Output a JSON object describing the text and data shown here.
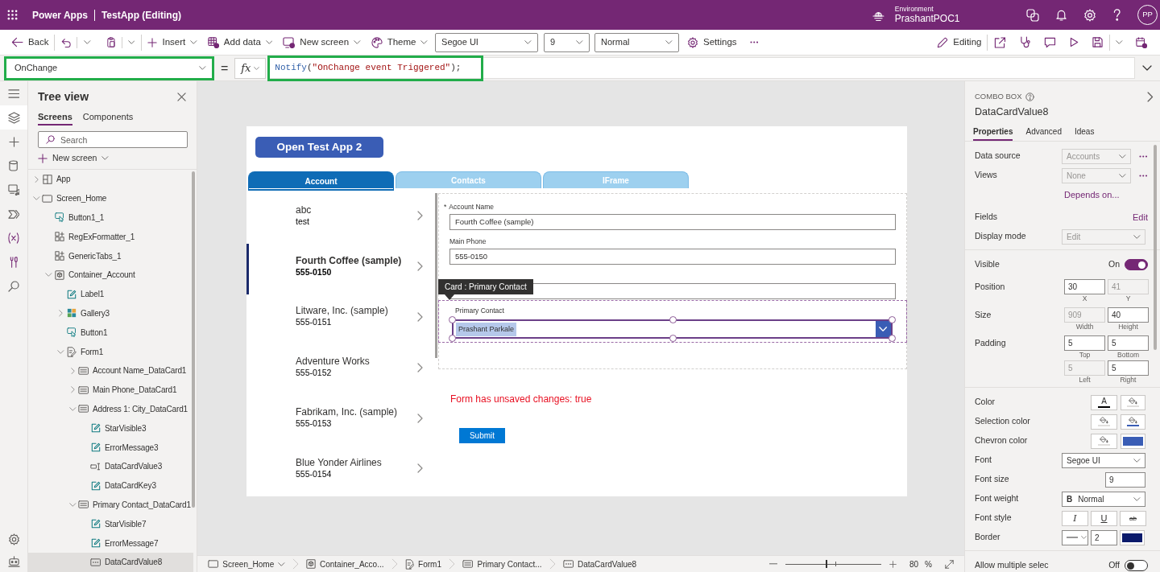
{
  "header": {
    "app_name": "Power Apps",
    "document_title": "TestApp (Editing)",
    "environment_label": "Environment",
    "environment_name": "PrashantPOC1",
    "avatar_initials": "PP"
  },
  "toolbar": {
    "back": "Back",
    "insert": "Insert",
    "add_data": "Add data",
    "new_screen": "New screen",
    "theme": "Theme",
    "font": "Segoe UI",
    "font_size": "9",
    "font_weight": "Normal",
    "settings": "Settings",
    "mode": "Editing"
  },
  "formula_bar": {
    "property": "OnChange",
    "property_highlighted": true,
    "equals": "=",
    "fx": "fx",
    "formula_highlighted": true,
    "formula": [
      {
        "kind": "function",
        "text": "Notify"
      },
      {
        "kind": "punctuation",
        "text": "("
      },
      {
        "kind": "string",
        "text": "\"OnChange event Triggered\""
      },
      {
        "kind": "punctuation",
        "text": ");"
      }
    ]
  },
  "rail": [
    {
      "selected": true
    },
    {
      "selected": false
    },
    {
      "selected": false
    },
    {
      "selected": false
    },
    {
      "selected": false
    },
    {
      "selected": false
    },
    {
      "selected": false
    },
    {
      "selected": false
    },
    {
      "selected": false
    },
    {
      "selected": false
    }
  ],
  "tree_view": {
    "title": "Tree view",
    "tabs": [
      {
        "label": "Screens",
        "selected": true
      },
      {
        "label": "Components",
        "selected": false
      }
    ],
    "search": {
      "placeholder": "Search"
    },
    "new_screen": "New screen",
    "items": [
      {
        "label": "App",
        "kind": "app",
        "expanded": false,
        "selected": false
      },
      {
        "label": "Screen_Home",
        "kind": "screen",
        "expanded": true,
        "selected": false,
        "children": [
          {
            "label": "Button1_1",
            "kind": "button",
            "selected": false
          },
          {
            "label": "RegExFormatter_1",
            "kind": "component",
            "selected": false
          },
          {
            "label": "GenericTabs_1",
            "kind": "component",
            "selected": false
          },
          {
            "label": "Container_Account",
            "kind": "container",
            "expanded": true,
            "selected": false,
            "children": [
              {
                "label": "Label1",
                "kind": "label",
                "selected": false
              },
              {
                "label": "Gallery3",
                "kind": "gallery",
                "expanded": false,
                "selected": false
              },
              {
                "label": "Button1",
                "kind": "button",
                "selected": false
              },
              {
                "label": "Form1",
                "kind": "form",
                "expanded": true,
                "selected": false,
                "children": [
                  {
                    "label": "Account Name_DataCard1",
                    "kind": "card",
                    "expanded": false,
                    "selected": false
                  },
                  {
                    "label": "Main Phone_DataCard1",
                    "kind": "card",
                    "expanded": false,
                    "selected": false
                  },
                  {
                    "label": "Address 1: City_DataCard1",
                    "kind": "card",
                    "expanded": true,
                    "selected": false,
                    "children": [
                      {
                        "label": "StarVisible3",
                        "kind": "label",
                        "selected": false
                      },
                      {
                        "label": "ErrorMessage3",
                        "kind": "label",
                        "selected": false
                      },
                      {
                        "label": "DataCardValue3",
                        "kind": "input",
                        "selected": false
                      },
                      {
                        "label": "DataCardKey3",
                        "kind": "label",
                        "selected": false
                      }
                    ]
                  },
                  {
                    "label": "Primary Contact_DataCard1",
                    "kind": "card",
                    "expanded": true,
                    "selected": false,
                    "children": [
                      {
                        "label": "StarVisible7",
                        "kind": "label",
                        "selected": false
                      },
                      {
                        "label": "ErrorMessage7",
                        "kind": "label",
                        "selected": false
                      },
                      {
                        "label": "DataCardValue8",
                        "kind": "combobox",
                        "selected": true
                      }
                    ]
                  }
                ]
              }
            ]
          }
        ]
      }
    ]
  },
  "canvas": {
    "open_button": "Open Test App 2",
    "tabs": [
      {
        "label": "Account",
        "selected": true
      },
      {
        "label": "Contacts",
        "selected": false
      },
      {
        "label": "IFrame",
        "selected": false
      }
    ],
    "gallery": [
      {
        "title": "abc",
        "subtitle": "test",
        "selected": false
      },
      {
        "title": "Fourth Coffee (sample)",
        "subtitle": "555-0150",
        "selected": true
      },
      {
        "title": "Litware, Inc. (sample)",
        "subtitle": "555-0151",
        "selected": false
      },
      {
        "title": "Adventure Works",
        "subtitle": "555-0152",
        "selected": false
      },
      {
        "title": "Fabrikam, Inc. (sample)",
        "subtitle": "555-0153",
        "selected": false
      },
      {
        "title": "Blue Yonder Airlines",
        "subtitle": "555-0154",
        "selected": false
      }
    ],
    "form_fields": [
      {
        "kind": "text",
        "label": "Account Name",
        "required_mark": "*",
        "value": "Fourth Coffee (sample)"
      },
      {
        "kind": "text",
        "label": "Main Phone",
        "value": "555-0150"
      },
      {
        "kind": "text"
      },
      {
        "kind": "combo",
        "label": "Primary Contact",
        "value": "Prashant Parkale",
        "selected": true
      }
    ],
    "tooltip": "Card : Primary Contact",
    "unsaved_message": "Form has unsaved changes: true",
    "submit_button": "Submit"
  },
  "properties_panel": {
    "control_type": "COMBO BOX",
    "control_name": "DataCardValue8",
    "tabs": [
      {
        "label": "Properties",
        "selected": true
      },
      {
        "label": "Advanced",
        "selected": false
      },
      {
        "label": "Ideas",
        "selected": false
      }
    ],
    "sections": [
      [
        {
          "kind": "dropdown",
          "label": "Data source",
          "value": "Accounts",
          "disabled": true,
          "more": true
        },
        {
          "kind": "dropdown",
          "label": "Views",
          "value": "None",
          "disabled": true,
          "more": true
        },
        {
          "kind": "link",
          "value": "Depends on..."
        },
        {
          "kind": "action",
          "label": "Fields",
          "value": "Edit"
        },
        {
          "kind": "dropdown",
          "label": "Display mode",
          "value": "Edit",
          "disabled": true
        }
      ],
      [
        {
          "kind": "toggle",
          "label": "Visible",
          "value": "On",
          "on": true
        },
        {
          "kind": "numbers",
          "label": "Position",
          "fields": [
            {
              "value": "30",
              "caption": "X",
              "disabled": false
            },
            {
              "value": "41",
              "caption": "Y",
              "disabled": true
            }
          ]
        },
        {
          "kind": "numbers",
          "label": "Size",
          "fields": [
            {
              "value": "909",
              "caption": "Width",
              "disabled": true
            },
            {
              "value": "40",
              "caption": "Height",
              "disabled": false
            }
          ]
        },
        {
          "kind": "numbers",
          "label": "Padding",
          "fields": [
            {
              "value": "5",
              "caption": "Top",
              "disabled": false
            },
            {
              "value": "5",
              "caption": "Bottom",
              "disabled": false
            },
            {
              "value": "5",
              "caption": "Left",
              "disabled": true
            },
            {
              "value": "5",
              "caption": "Right",
              "disabled": false
            }
          ]
        }
      ],
      [
        {
          "kind": "colors",
          "label": "Color",
          "swatches": [
            {
              "kind": "text",
              "glyph": "A",
              "color": "#000000"
            },
            {
              "kind": "fill",
              "color": "#e1dfdd"
            }
          ]
        },
        {
          "kind": "colors",
          "label": "Selection color",
          "swatches": [
            {
              "kind": "fill",
              "color": "#e1dfdd"
            },
            {
              "kind": "fill",
              "color": "#3a5db5"
            }
          ]
        },
        {
          "kind": "colors",
          "label": "Chevron color",
          "swatches": [
            {
              "kind": "fill",
              "color": "#e1dfdd"
            },
            {
              "kind": "solid",
              "color": "#3a5db5"
            }
          ]
        },
        {
          "kind": "dropdown",
          "label": "Font",
          "value": "Segoe UI",
          "disabled": false
        },
        {
          "kind": "input",
          "label": "Font size",
          "value": "9"
        },
        {
          "kind": "dropdown",
          "label": "Font weight",
          "prefix": "B",
          "value": "Normal",
          "disabled": false
        },
        {
          "kind": "styles",
          "label": "Font style",
          "buttons": [
            {
              "kind": "italic",
              "glyph": "I",
              "selected": false
            },
            {
              "kind": "underline",
              "glyph": "U",
              "selected": false
            },
            {
              "kind": "strike",
              "glyph": "ab",
              "selected": false
            }
          ]
        },
        {
          "kind": "border",
          "label": "Border",
          "value": "2",
          "color": "#0b1a6b"
        }
      ],
      [
        {
          "kind": "toggle",
          "label": "Allow multiple selec",
          "value": "Off",
          "on": false
        }
      ]
    ]
  },
  "status_bar": {
    "breadcrumbs": [
      {
        "label": "Screen_Home",
        "kind": "screen",
        "dropdown": true
      },
      {
        "label": "Container_Acco...",
        "kind": "container",
        "dropdown": false
      },
      {
        "label": "Form1",
        "kind": "form",
        "dropdown": false
      },
      {
        "label": "Primary Contact...",
        "kind": "card",
        "dropdown": false
      },
      {
        "label": "DataCardValue8",
        "kind": "combobox",
        "dropdown": false
      }
    ],
    "zoom": {
      "level": 0.42,
      "value": "80",
      "unit": "%"
    }
  }
}
